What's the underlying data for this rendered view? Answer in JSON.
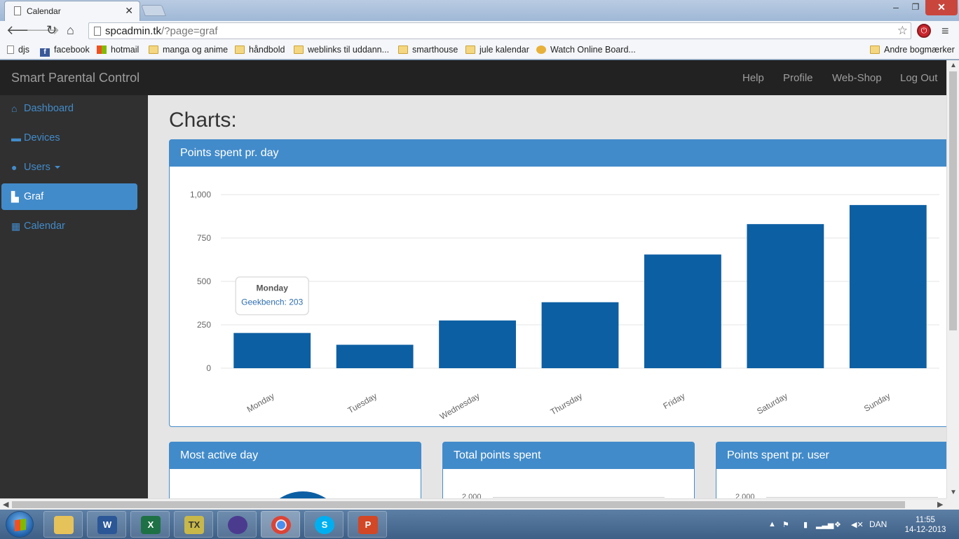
{
  "browser": {
    "tab_title": "Calendar",
    "url_host": "spcadmin.tk",
    "url_path": "/?page=graf",
    "bookmarks": [
      "djs",
      "facebook",
      "hotmail",
      "manga og anime",
      "håndbold",
      "weblinks til uddann...",
      "smarthouse",
      "jule kalendar",
      "Watch Online Board..."
    ],
    "other_bookmarks": "Andre bogmærker"
  },
  "app": {
    "brand": "Smart Parental Control",
    "nav": [
      "Help",
      "Profile",
      "Web-Shop",
      "Log Out"
    ],
    "sidebar": [
      {
        "label": "Dashboard",
        "icon": "home-icon"
      },
      {
        "label": "Devices",
        "icon": "laptop-icon"
      },
      {
        "label": "Users",
        "icon": "user-icon"
      },
      {
        "label": "Graf",
        "icon": "bar-chart-icon"
      },
      {
        "label": "Calendar",
        "icon": "calendar-icon"
      }
    ],
    "active_item": "Graf",
    "page_title": "Charts:",
    "panels": {
      "main": "Points spent pr. day",
      "most_active": "Most active day",
      "total": "Total points spent",
      "per_user": "Points spent pr. user",
      "mini_tick": "2,000"
    },
    "accent_color": "#428bca",
    "bar_color": "#0d5fa3"
  },
  "chart_data": {
    "type": "bar",
    "categories": [
      "Monday",
      "Tuesday",
      "Wednesday",
      "Thursday",
      "Friday",
      "Saturday",
      "Sunday"
    ],
    "series": [
      {
        "name": "Geekbench",
        "values": [
          203,
          135,
          275,
          380,
          655,
          830,
          940
        ]
      }
    ],
    "y_ticks": [
      "0",
      "250",
      "500",
      "750",
      "1,000"
    ],
    "ylim": [
      0,
      1000
    ],
    "grid": true,
    "tooltip": {
      "title": "Monday",
      "text": "Geekbench: 203"
    }
  },
  "taskbar": {
    "language": "DAN",
    "time": "11:55",
    "date": "14-12-2013"
  }
}
